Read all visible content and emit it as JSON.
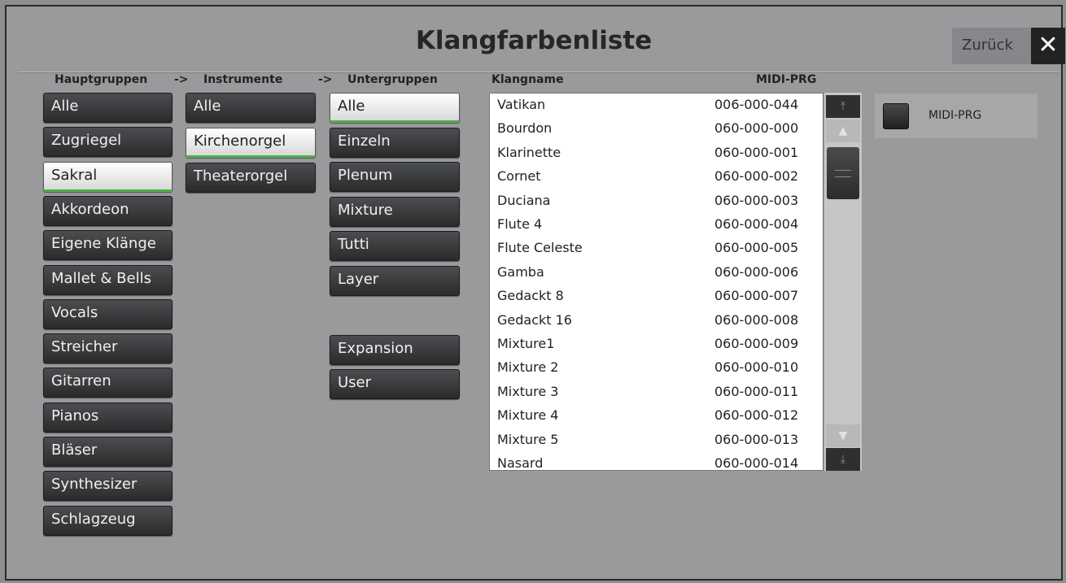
{
  "window": {
    "title": "Klangfarbenliste",
    "back_label": "Zurück",
    "close_glyph": "✕"
  },
  "headers": {
    "hauptgruppen": "Hauptgruppen",
    "arrow1": "->",
    "instrumente": "Instrumente",
    "arrow2": "->",
    "untergruppen": "Untergruppen",
    "klangname": "Klangname",
    "midi_prg": "MIDI-PRG"
  },
  "hauptgruppen": [
    {
      "label": "Alle",
      "selected": false
    },
    {
      "label": "Zugriegel",
      "selected": false
    },
    {
      "label": "Sakral",
      "selected": true
    },
    {
      "label": "Akkordeon",
      "selected": false
    },
    {
      "label": "Eigene Klänge",
      "selected": false
    },
    {
      "label": "Mallet & Bells",
      "selected": false
    },
    {
      "label": "Vocals",
      "selected": false
    },
    {
      "label": "Streicher",
      "selected": false
    },
    {
      "label": "Gitarren",
      "selected": false
    },
    {
      "label": "Pianos",
      "selected": false
    },
    {
      "label": "Bläser",
      "selected": false
    },
    {
      "label": "Synthesizer",
      "selected": false
    },
    {
      "label": "Schlagzeug",
      "selected": false
    }
  ],
  "instrumente": [
    {
      "label": "Alle",
      "selected": false
    },
    {
      "label": "Kirchenorgel",
      "selected": true
    },
    {
      "label": "Theaterorgel",
      "selected": false
    }
  ],
  "untergruppen": [
    {
      "label": "Alle",
      "selected": true
    },
    {
      "label": "Einzeln",
      "selected": false
    },
    {
      "label": "Plenum",
      "selected": false
    },
    {
      "label": "Mixture",
      "selected": false
    },
    {
      "label": "Tutti",
      "selected": false
    },
    {
      "label": "Layer",
      "selected": false
    }
  ],
  "extra_groups": [
    {
      "label": "Expansion",
      "selected": false
    },
    {
      "label": "User",
      "selected": false
    }
  ],
  "sounds": [
    {
      "name": "Vatikan",
      "prg": "006-000-044"
    },
    {
      "name": "Bourdon",
      "prg": "060-000-000"
    },
    {
      "name": "Klarinette",
      "prg": "060-000-001"
    },
    {
      "name": "Cornet",
      "prg": "060-000-002"
    },
    {
      "name": "Duciana",
      "prg": "060-000-003"
    },
    {
      "name": "Flute 4",
      "prg": "060-000-004"
    },
    {
      "name": "Flute Celeste",
      "prg": "060-000-005"
    },
    {
      "name": "Gamba",
      "prg": "060-000-006"
    },
    {
      "name": "Gedackt 8",
      "prg": "060-000-007"
    },
    {
      "name": "Gedackt 16",
      "prg": "060-000-008"
    },
    {
      "name": "Mixture1",
      "prg": "060-000-009"
    },
    {
      "name": "Mixture 2",
      "prg": "060-000-010"
    },
    {
      "name": "Mixture 3",
      "prg": "060-000-011"
    },
    {
      "name": "Mixture 4",
      "prg": "060-000-012"
    },
    {
      "name": "Mixture 5",
      "prg": "060-000-013"
    },
    {
      "name": "Nasard",
      "prg": "060-000-014"
    }
  ],
  "scrollbar": {
    "top_glyph": "⤒",
    "up_glyph": "▲",
    "down_glyph": "▼",
    "bottom_glyph": "⤓"
  },
  "midi_toggle": {
    "label": "MIDI-PRG",
    "checked": false
  },
  "colors": {
    "accent_selected": "#4fb04a",
    "button_dark": "#2a2b2d",
    "background": "#989a9c"
  }
}
